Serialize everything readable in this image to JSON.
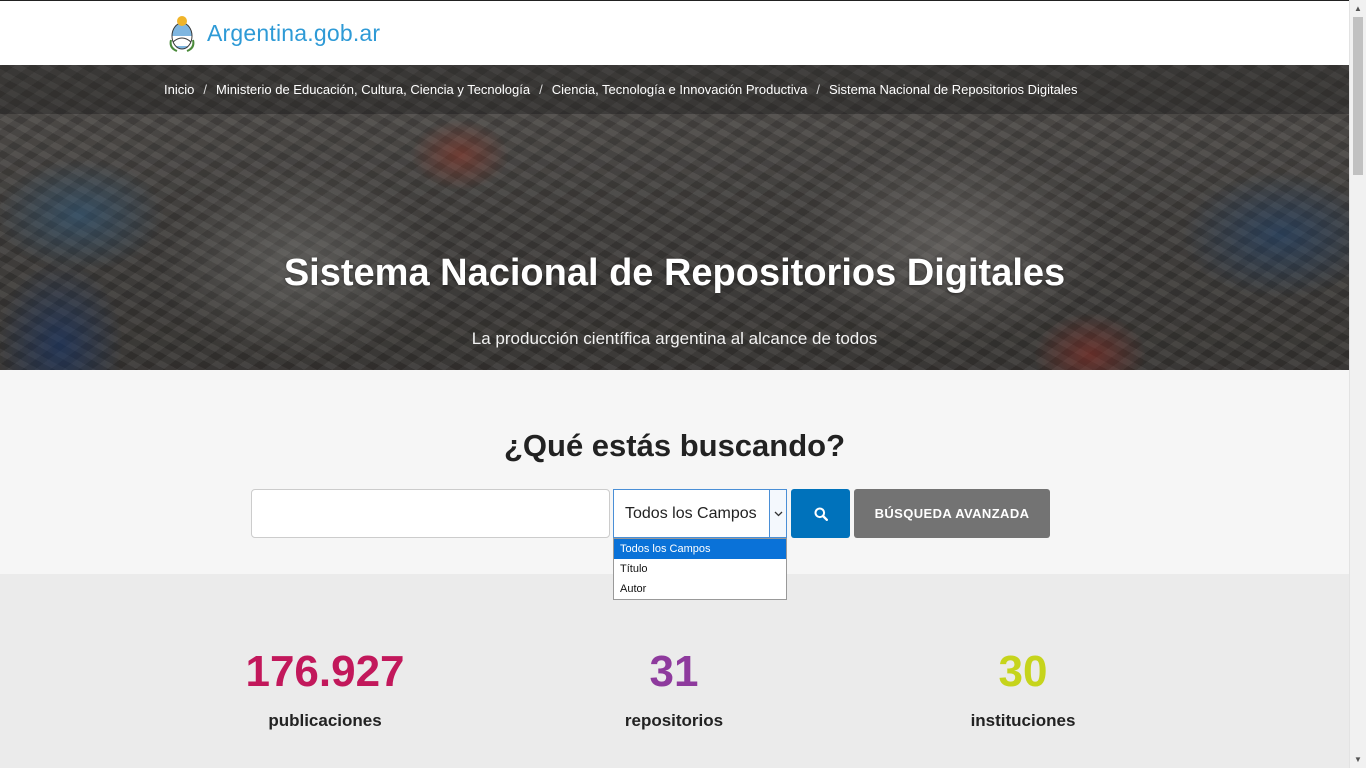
{
  "header": {
    "logo_text": "Argentina.gob.ar"
  },
  "breadcrumb": [
    "Inicio",
    "Ministerio de Educación, Cultura, Ciencia y Tecnología",
    "Ciencia, Tecnología e Innovación Productiva",
    "Sistema Nacional de Repositorios Digitales"
  ],
  "hero": {
    "title": "Sistema Nacional de Repositorios Digitales",
    "subtitle": "La producción científica argentina al alcance de todos"
  },
  "search": {
    "heading": "¿Qué estás buscando?",
    "input_value": "",
    "select_value": "Todos los Campos",
    "options": [
      "Todos los Campos",
      "Título",
      "Autor"
    ],
    "selected_option": "Todos los Campos",
    "search_icon": "search-icon",
    "advanced_label": "BÚSQUEDA AVANZADA"
  },
  "stats": {
    "publications": {
      "value": "176.927",
      "label": "publicaciones",
      "color": "#c2185b"
    },
    "repositories": {
      "value": "31",
      "label": "repositorios",
      "color": "#8e3a9d"
    },
    "institutions": {
      "value": "30",
      "label": "instituciones",
      "color": "#c6d41c"
    }
  },
  "colors": {
    "brand_blue": "#2e9ad6",
    "primary_button": "#0072bb",
    "secondary_button": "#737373"
  }
}
